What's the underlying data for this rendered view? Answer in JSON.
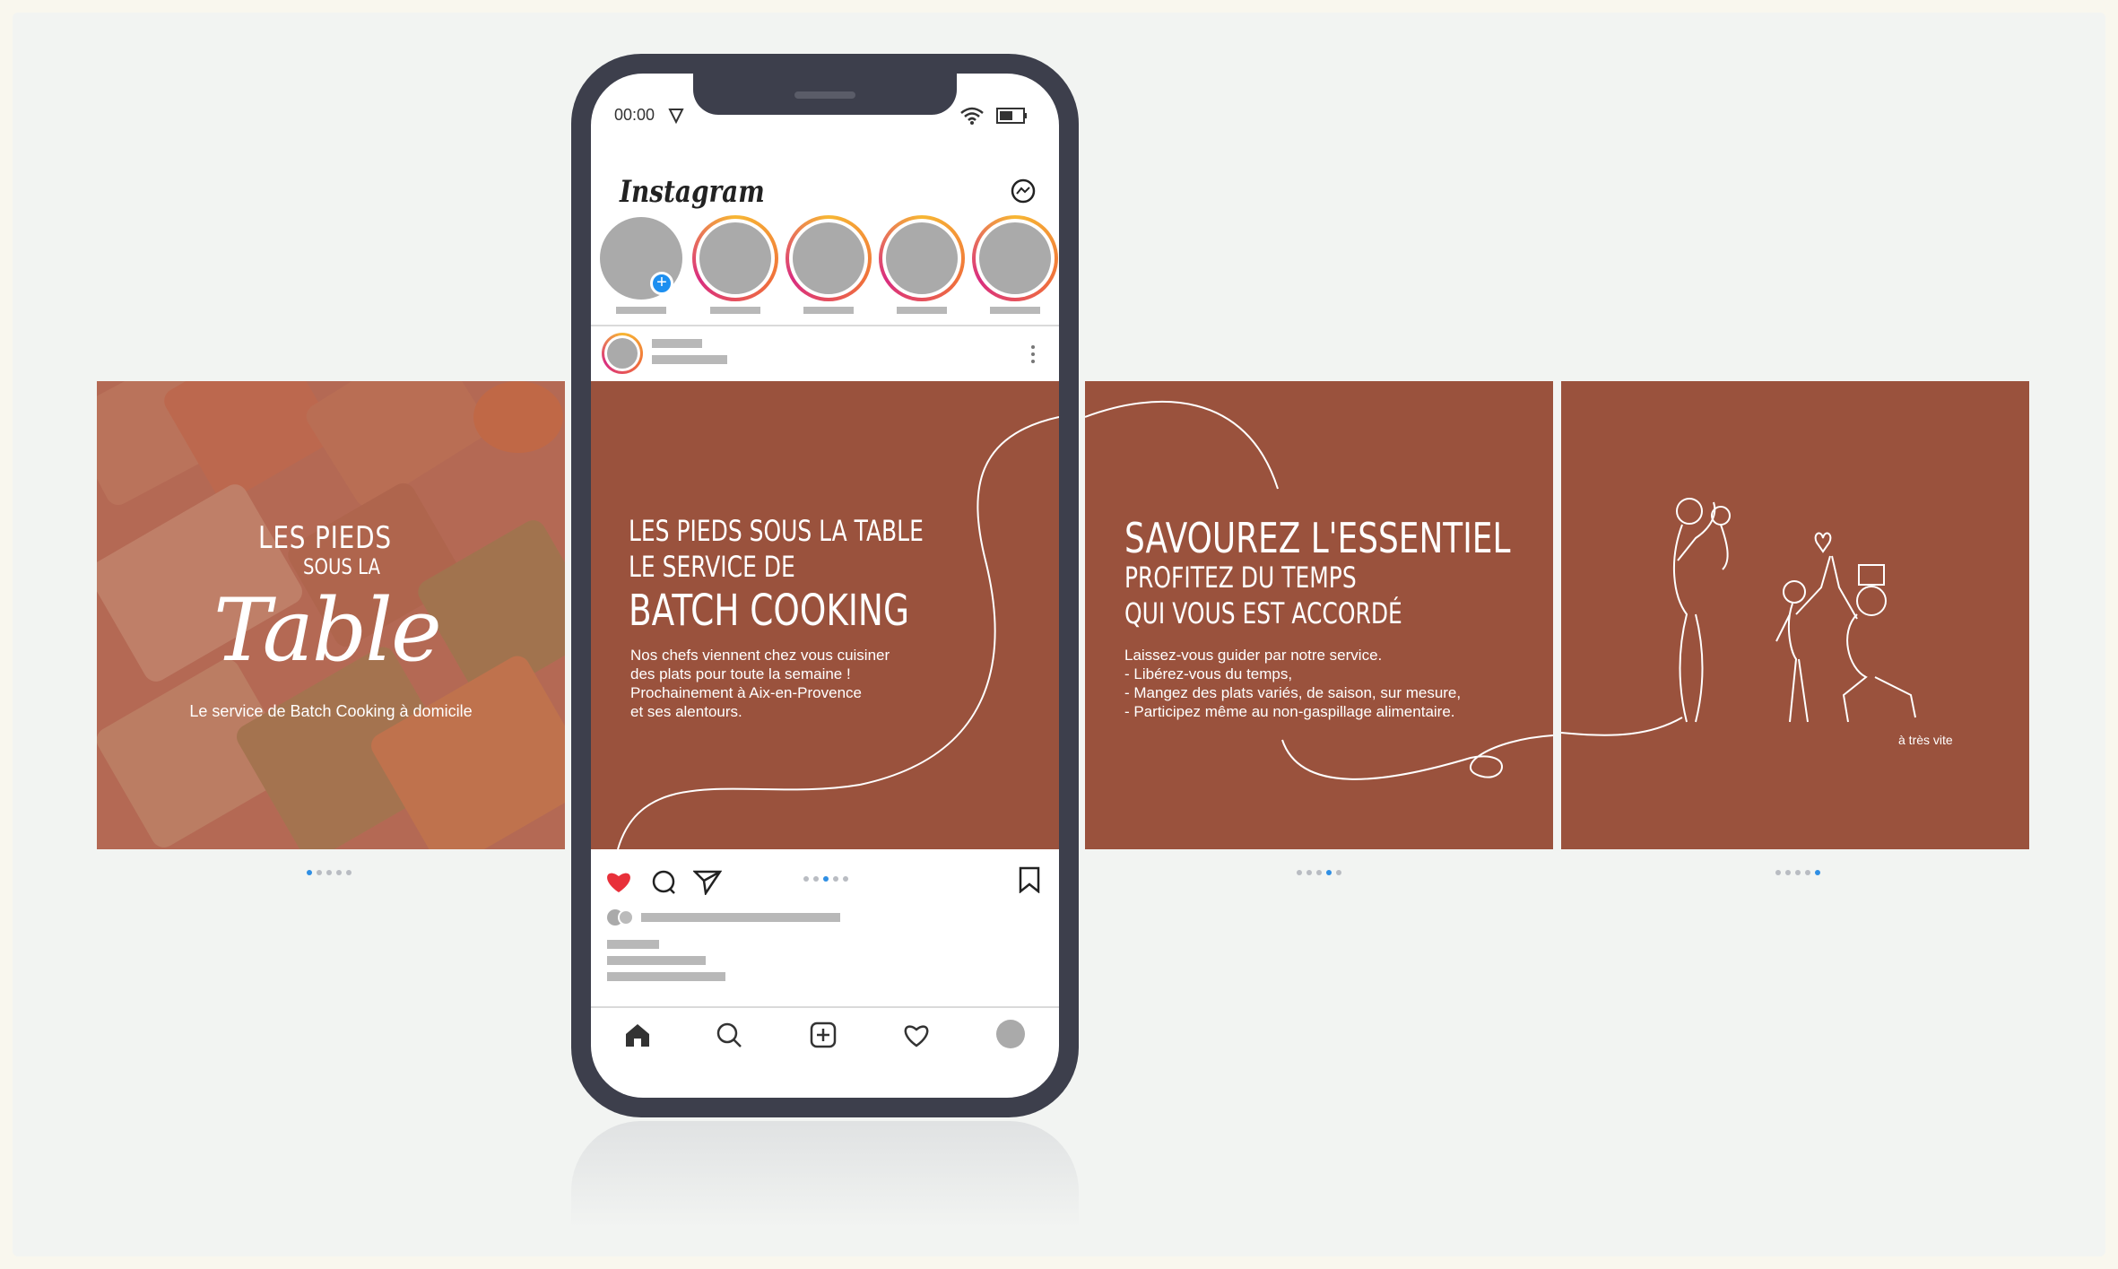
{
  "slide1": {
    "title": "LES PIEDS",
    "subtitle": "SOUS LA",
    "script": "Table",
    "tagline": "Le service de Batch Cooking à domicile"
  },
  "slide2": {
    "line1": "LES PIEDS SOUS LA TABLE",
    "line2": "LE SERVICE DE",
    "line3": "BATCH COOKING",
    "body": "Nos chefs viennent chez vous cuisiner\ndes plats pour toute la semaine !\nProchainement à Aix-en-Provence\net ses alentours."
  },
  "slide3": {
    "line1": "SAVOUREZ L'ESSENTIEL",
    "line2": "PROFITEZ DU TEMPS",
    "line3": "QUI VOUS EST ACCORDÉ",
    "body": "Laissez-vous guider par notre service.\n- Libérez-vous du temps,\n- Mangez des plats variés, de saison, sur mesure,\n- Participez même au non-gaspillage alimentaire."
  },
  "slide4": {
    "caption": "à très vite"
  },
  "phone": {
    "time": "00:00",
    "app_name": "Instagram",
    "icons": [
      "location-arrow-icon",
      "wifi-icon",
      "battery-icon",
      "messenger-icon",
      "plus-icon",
      "more-icon",
      "heart-icon",
      "comment-icon",
      "send-icon",
      "bookmark-icon",
      "home-icon",
      "search-icon",
      "add-post-icon",
      "activity-heart-icon",
      "profile-icon"
    ]
  },
  "colors": {
    "terracotta": "#9a523d",
    "phone_frame": "#3d3f4c",
    "like_red": "#e8303a",
    "dot_active": "#2f8fe4"
  },
  "carousel": {
    "total_slides": 5,
    "active_slide_indicators": [
      1,
      3,
      4,
      5
    ]
  }
}
